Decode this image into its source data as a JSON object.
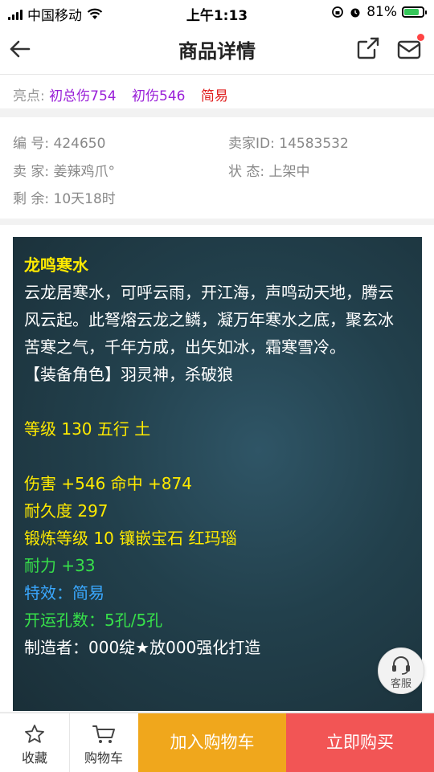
{
  "status": {
    "carrier": "中国移动",
    "time": "上午1:13",
    "battery": "81%",
    "battery_level": 0.81
  },
  "nav": {
    "title": "商品详情"
  },
  "highlight": {
    "label": "亮点:",
    "tag1": "初总伤754",
    "tag2": "初伤546",
    "tag3": "简易"
  },
  "info": {
    "id_label": "编 号:",
    "id_value": "424650",
    "seller_id_label": "卖家ID:",
    "seller_id_value": "14583532",
    "seller_label": "卖 家:",
    "seller_value": "姜辣鸡爪°",
    "status_label": "状 态:",
    "status_value": "上架中",
    "remain_label": "剩 余:",
    "remain_value": "10天18时"
  },
  "item": {
    "name": "龙鸣寒水",
    "desc1": "云龙居寒水，可呼云雨，开江海，声鸣动天地，腾云",
    "desc2": "风云起。此弩熔云龙之鳞，凝万年寒水之底，聚玄冰",
    "desc3": "苦寒之气，千年方成，出矢如冰，霜寒雪冷。",
    "roles": "【装备角色】羽灵神，杀破狼",
    "level": "等级 130 五行 土",
    "damage": "伤害 +546 命中 +874",
    "durability": "耐久度 297",
    "forge": "锻炼等级 10 镶嵌宝石 红玛瑙",
    "stamina": "耐力 +33",
    "effect": "特效：简易",
    "holes": "开运孔数：5孔/5孔",
    "maker": "制造者：000绽★放000强化打造"
  },
  "service": {
    "label": "客服"
  },
  "bottom": {
    "fav": "收藏",
    "cart": "购物车",
    "add_cart": "加入购物车",
    "buy_now": "立即购买"
  },
  "icons": {
    "back": "back-arrow-icon",
    "share": "share-icon",
    "message": "mail-icon",
    "favorite": "star-icon",
    "cart": "cart-icon",
    "service": "headset-icon"
  },
  "colors": {
    "add_cart_bg": "#f0a71c",
    "buy_bg": "#f25555",
    "highlight_purple": "#9a20d8",
    "highlight_red": "#e02020",
    "item_yellow": "#ffea00",
    "item_green": "#37e04a",
    "item_blue": "#3aa8ff"
  }
}
